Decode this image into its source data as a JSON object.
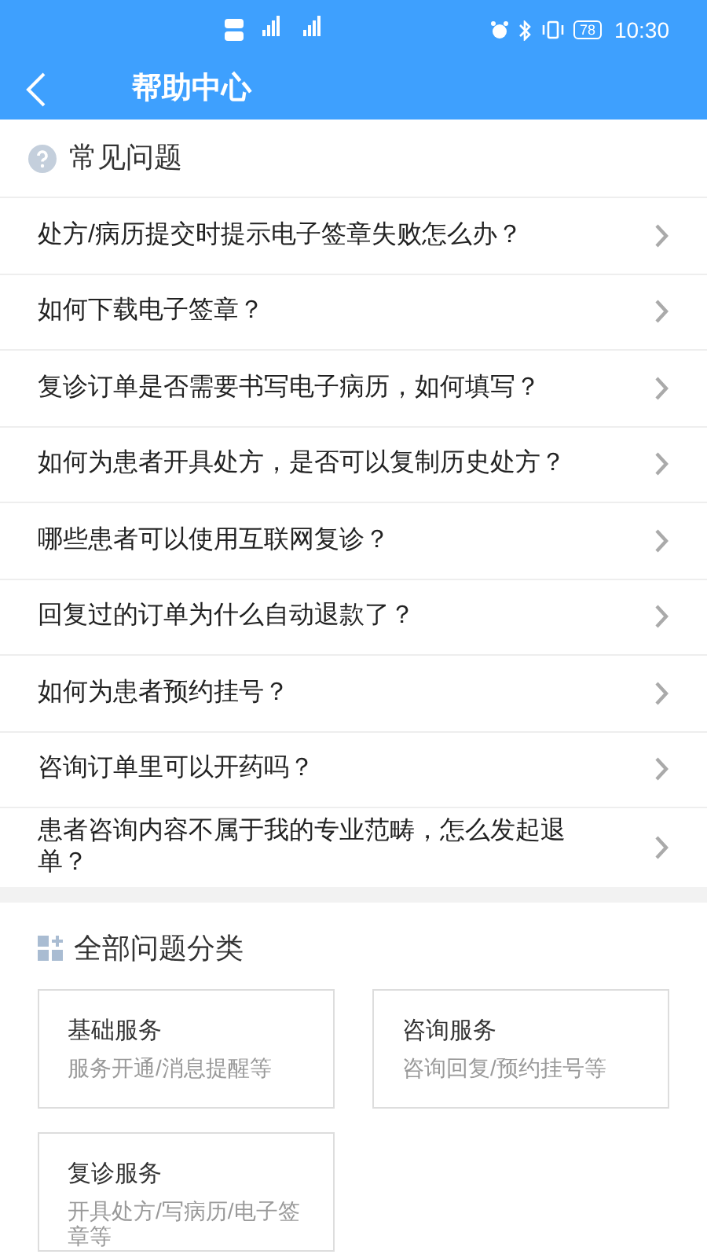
{
  "status_bar": {
    "battery": "78",
    "time": "10:30"
  },
  "header": {
    "title": "帮助中心"
  },
  "faq": {
    "title": "常见问题",
    "items": [
      {
        "text": "处方/病历提交时提示电子签章失败怎么办？"
      },
      {
        "text": "如何下载电子签章？"
      },
      {
        "text": "复诊订单是否需要书写电子病历，如何填写？"
      },
      {
        "text": "如何为患者开具处方，是否可以复制历史处方？"
      },
      {
        "text": "哪些患者可以使用互联网复诊？"
      },
      {
        "text": "回复过的订单为什么自动退款了？"
      },
      {
        "text": "如何为患者预约挂号？"
      },
      {
        "text": "咨询订单里可以开药吗？"
      },
      {
        "text": "患者咨询内容不属于我的专业范畴，怎么发起退单？"
      }
    ]
  },
  "categories": {
    "title": "全部问题分类",
    "items": [
      {
        "title": "基础服务",
        "description": "服务开通/消息提醒等"
      },
      {
        "title": "咨询服务",
        "description": "咨询回复/预约挂号等"
      },
      {
        "title": "复诊服务",
        "description": "开具处方/写病历/电子签章等"
      }
    ]
  }
}
